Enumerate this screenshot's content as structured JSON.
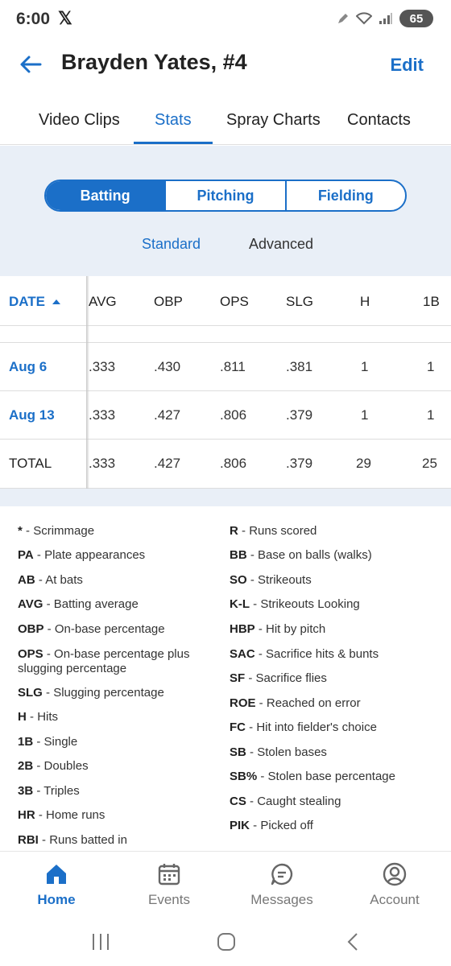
{
  "status_bar": {
    "time": "6:00",
    "x_label": "𝕏",
    "battery": "65"
  },
  "header": {
    "title": "Brayden Yates, #4",
    "edit_label": "Edit"
  },
  "tabs": [
    {
      "label": "Video Clips"
    },
    {
      "label": "Stats"
    },
    {
      "label": "Spray Charts"
    },
    {
      "label": "Contacts"
    }
  ],
  "segments": [
    {
      "label": "Batting"
    },
    {
      "label": "Pitching"
    },
    {
      "label": "Fielding"
    }
  ],
  "sub_toggle": {
    "standard": "Standard",
    "advanced": "Advanced"
  },
  "table": {
    "headers": [
      "DATE",
      "AVG",
      "OBP",
      "OPS",
      "SLG",
      "H",
      "1B"
    ],
    "rows": [
      [
        "Aug 6",
        ".333",
        ".430",
        ".811",
        ".381",
        "1",
        "1"
      ],
      [
        "Aug 13",
        ".333",
        ".427",
        ".806",
        ".379",
        "1",
        "1"
      ]
    ],
    "total": [
      "TOTAL",
      ".333",
      ".427",
      ".806",
      ".379",
      "29",
      "25"
    ]
  },
  "legend": {
    "left": [
      {
        "abbr": "*",
        "desc": "Scrimmage"
      },
      {
        "abbr": "PA",
        "desc": "Plate appearances"
      },
      {
        "abbr": "AB",
        "desc": "At bats"
      },
      {
        "abbr": "AVG",
        "desc": "Batting average"
      },
      {
        "abbr": "OBP",
        "desc": "On-base percentage"
      },
      {
        "abbr": "OPS",
        "desc": "On-base percentage plus slugging percentage"
      },
      {
        "abbr": "SLG",
        "desc": "Slugging percentage"
      },
      {
        "abbr": "H",
        "desc": "Hits"
      },
      {
        "abbr": "1B",
        "desc": "Single"
      },
      {
        "abbr": "2B",
        "desc": "Doubles"
      },
      {
        "abbr": "3B",
        "desc": "Triples"
      },
      {
        "abbr": "HR",
        "desc": "Home runs"
      },
      {
        "abbr": "RBI",
        "desc": "Runs batted in"
      }
    ],
    "right": [
      {
        "abbr": "R",
        "desc": "Runs scored"
      },
      {
        "abbr": "BB",
        "desc": "Base on balls (walks)"
      },
      {
        "abbr": "SO",
        "desc": "Strikeouts"
      },
      {
        "abbr": "K-L",
        "desc": "Strikeouts Looking"
      },
      {
        "abbr": "HBP",
        "desc": "Hit by pitch"
      },
      {
        "abbr": "SAC",
        "desc": "Sacrifice hits & bunts"
      },
      {
        "abbr": "SF",
        "desc": "Sacrifice flies"
      },
      {
        "abbr": "ROE",
        "desc": "Reached on error"
      },
      {
        "abbr": "FC",
        "desc": "Hit into fielder's choice"
      },
      {
        "abbr": "SB",
        "desc": "Stolen bases"
      },
      {
        "abbr": "SB%",
        "desc": "Stolen base percentage"
      },
      {
        "abbr": "CS",
        "desc": "Caught stealing"
      },
      {
        "abbr": "PIK",
        "desc": "Picked off"
      }
    ]
  },
  "bottom_nav": [
    {
      "label": "Home",
      "icon": "home-icon"
    },
    {
      "label": "Events",
      "icon": "calendar-icon"
    },
    {
      "label": "Messages",
      "icon": "chat-icon"
    },
    {
      "label": "Account",
      "icon": "account-icon"
    }
  ],
  "colors": {
    "accent": "#1b6fc8",
    "panel": "#e9eff7"
  }
}
